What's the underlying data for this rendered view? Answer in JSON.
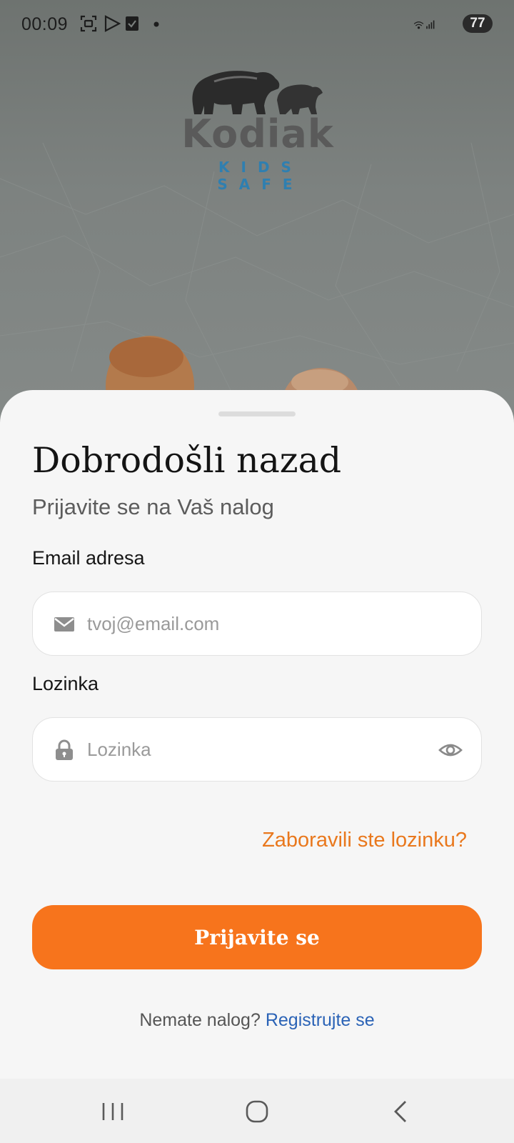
{
  "status_bar": {
    "time": "00:09",
    "battery": "77",
    "icons": [
      "screenshot-icon",
      "play-store-icon",
      "checkbox-icon",
      "dot-icon",
      "wifi-icon",
      "signal-icon"
    ]
  },
  "logo": {
    "wordmark": "Kodiak",
    "tagline": "KIDS SAFE"
  },
  "login": {
    "title": "Dobrodošli nazad",
    "subtitle": "Prijavite se na Vaš nalog",
    "email_label": "Email adresa",
    "email_placeholder": "tvoj@email.com",
    "password_label": "Lozinka",
    "password_placeholder": "Lozinka",
    "forgot_password": "Zaboravili ste lozinku?",
    "submit": "Prijavite se",
    "no_account": "Nemate nalog?",
    "register": "Registrujte se"
  },
  "colors": {
    "accent": "#f7741c",
    "link": "#2b63b6",
    "forgot": "#e9781d",
    "tagline": "#2f7fb0"
  }
}
